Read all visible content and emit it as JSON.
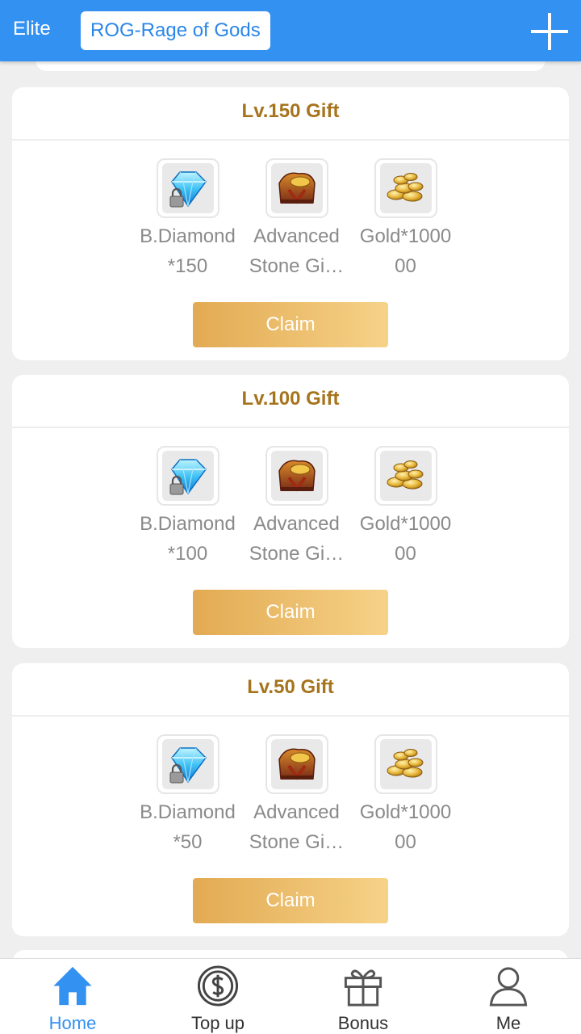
{
  "header": {
    "title": "Elite",
    "game_name": "ROG-Rage of Gods"
  },
  "gifts": [
    {
      "title": "Lv.150 Gift",
      "items": [
        {
          "label": "B.Diamond*150",
          "icon": "locked-diamond-icon"
        },
        {
          "label": "Advanced Stone Gi…",
          "icon": "stone-chest-icon"
        },
        {
          "label": "Gold*100000",
          "icon": "gold-coins-icon"
        }
      ],
      "button": "Claim"
    },
    {
      "title": "Lv.100 Gift",
      "items": [
        {
          "label": "B.Diamond*100",
          "icon": "locked-diamond-icon"
        },
        {
          "label": "Advanced Stone Gi…",
          "icon": "stone-chest-icon"
        },
        {
          "label": "Gold*100000",
          "icon": "gold-coins-icon"
        }
      ],
      "button": "Claim"
    },
    {
      "title": "Lv.50 Gift",
      "items": [
        {
          "label": "B.Diamond*50",
          "icon": "locked-diamond-icon"
        },
        {
          "label": "Advanced Stone Gi…",
          "icon": "stone-chest-icon"
        },
        {
          "label": "Gold*100000",
          "icon": "gold-coins-icon"
        }
      ],
      "button": "Claim"
    }
  ],
  "nav": {
    "items": [
      {
        "label": "Home",
        "icon": "home-icon",
        "active": true
      },
      {
        "label": "Top up",
        "icon": "dollar-coin-icon",
        "active": false
      },
      {
        "label": "Bonus",
        "icon": "gift-icon",
        "active": false
      },
      {
        "label": "Me",
        "icon": "user-icon",
        "active": false
      }
    ]
  },
  "colors": {
    "header_bg": "#3391f1",
    "gift_title": "#a6741d",
    "claim_gradient_start": "#e2aa52",
    "claim_gradient_end": "#f6d288",
    "nav_active": "#3391f1"
  }
}
